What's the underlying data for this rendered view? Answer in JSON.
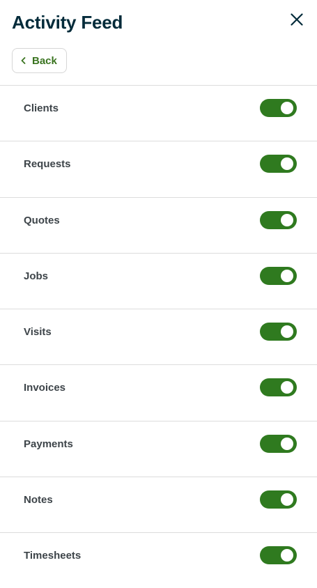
{
  "header": {
    "title": "Activity Feed",
    "close_icon": "close-icon",
    "back_label": "Back",
    "back_icon": "chevron-left-icon"
  },
  "settings": {
    "items": [
      {
        "label": "Clients",
        "enabled": true
      },
      {
        "label": "Requests",
        "enabled": true
      },
      {
        "label": "Quotes",
        "enabled": true
      },
      {
        "label": "Jobs",
        "enabled": true
      },
      {
        "label": "Visits",
        "enabled": true
      },
      {
        "label": "Invoices",
        "enabled": true
      },
      {
        "label": "Payments",
        "enabled": true
      },
      {
        "label": "Notes",
        "enabled": true
      },
      {
        "label": "Timesheets",
        "enabled": true
      }
    ]
  },
  "colors": {
    "title": "#032b3a",
    "accent": "#2f7a1f",
    "back_text": "#3a7420",
    "row_text": "#3d4449",
    "divider": "#dcdcdc"
  }
}
